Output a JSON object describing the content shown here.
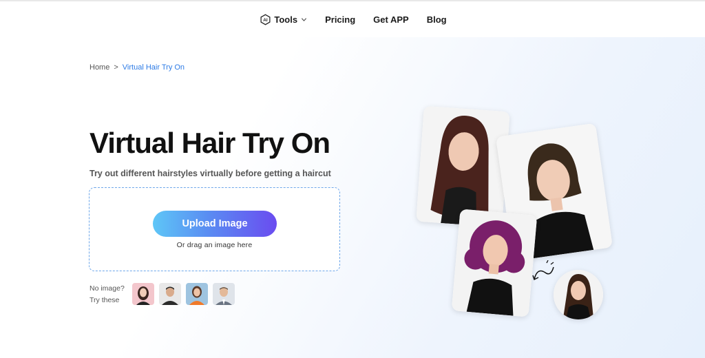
{
  "nav": {
    "items": [
      {
        "label": "Tools",
        "icon": "ai-chip-icon",
        "has_dropdown": true
      },
      {
        "label": "Pricing"
      },
      {
        "label": "Get APP"
      },
      {
        "label": "Blog"
      }
    ]
  },
  "breadcrumb": {
    "home": "Home",
    "separator": ">",
    "current": "Virtual Hair Try On"
  },
  "hero": {
    "title": "Virtual Hair Try On",
    "subtitle": "Try out different hairstyles virtually before getting a haircut"
  },
  "upload": {
    "button_label": "Upload Image",
    "hint": "Or drag an image here"
  },
  "samples": {
    "label_line1": "No image?",
    "label_line2": "Try these"
  },
  "colors": {
    "accent_blue": "#2d7be5",
    "dashed_border": "#6ca6ea",
    "button_gradient_start": "#5ec6f7",
    "button_gradient_end": "#6a4cf0"
  }
}
